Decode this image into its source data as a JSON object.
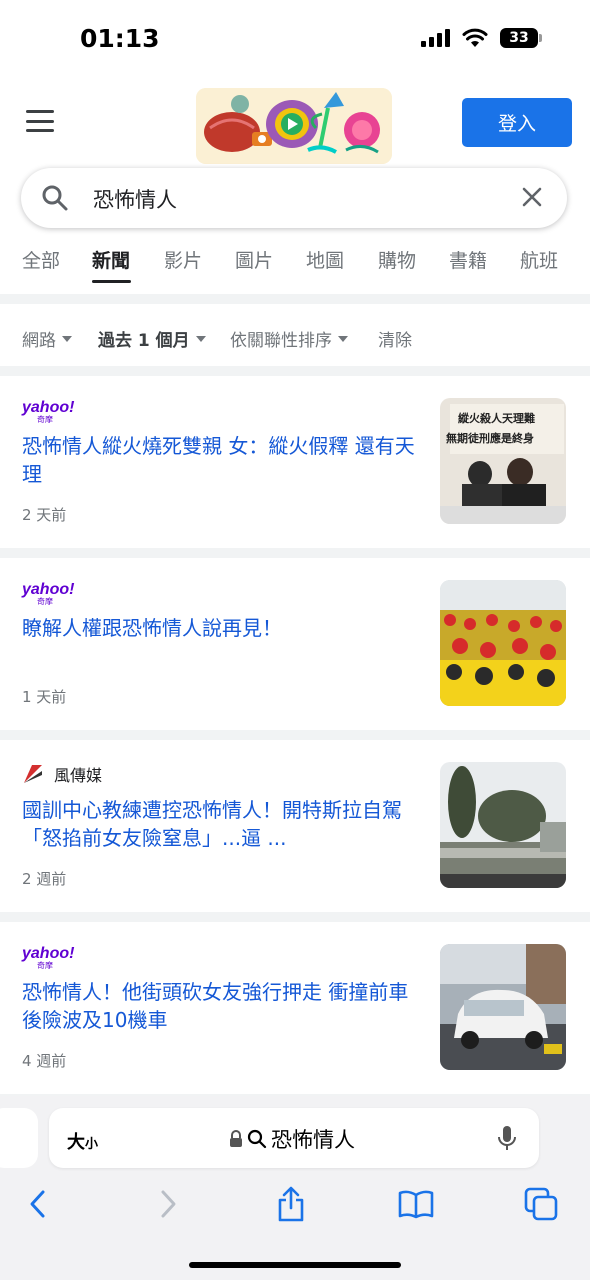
{
  "status": {
    "time": "01:13",
    "battery": "33"
  },
  "header": {
    "signin_label": "登入"
  },
  "search": {
    "query": "恐怖情人"
  },
  "tabs": [
    {
      "label": "全部"
    },
    {
      "label": "新聞"
    },
    {
      "label": "影片"
    },
    {
      "label": "圖片"
    },
    {
      "label": "地圖"
    },
    {
      "label": "購物"
    },
    {
      "label": "書籍"
    },
    {
      "label": "航班"
    }
  ],
  "active_tab": "新聞",
  "filters": [
    {
      "label": "網路"
    },
    {
      "label": "過去 1 個月"
    },
    {
      "label": "依關聯性排序"
    },
    {
      "label": "清除"
    }
  ],
  "results": [
    {
      "source_logo": "yahoo!",
      "source_sub": "奇摩",
      "title": "恐怖情人縱火燒死雙親 女：縱火假釋 還有天理",
      "age": "2 天前",
      "thumb_text": [
        "縱火殺人天理難",
        "無期徒刑應是終身"
      ]
    },
    {
      "source_logo": "yahoo!",
      "source_sub": "奇摩",
      "title": "瞭解人權跟恐怖情人說再見！",
      "age": "1 天前"
    },
    {
      "source_name": "風傳媒",
      "title": "國訓中心教練遭控恐怖情人！開特斯拉自駕「怒掐前女友險窒息」...逼 ...",
      "age": "2 週前"
    },
    {
      "source_logo": "yahoo!",
      "source_sub": "奇摩",
      "title": "恐怖情人！他街頭砍女友強行押走 衝撞前車後險波及10機車",
      "age": "4 週前"
    }
  ],
  "browser": {
    "text_size_label": "大",
    "text_size_small": "小",
    "address": "恐怖情人"
  },
  "colors": {
    "accent": "#1a73e8",
    "link": "#1558d6",
    "yahoo": "#6001d2"
  },
  "icons": [
    "menu-icon",
    "search-icon",
    "close-icon",
    "lock-icon",
    "microphone-icon",
    "back-icon",
    "forward-icon",
    "share-icon",
    "bookmarks-icon",
    "tabs-icon"
  ]
}
